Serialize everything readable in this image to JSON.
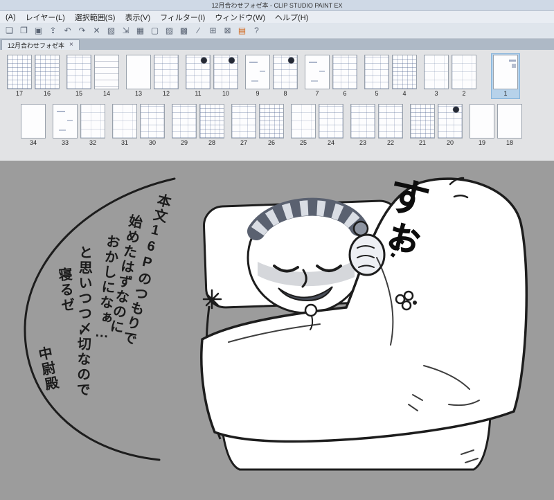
{
  "window": {
    "title": "12月合わせフォゼ本 - CLIP STUDIO PAINT EX"
  },
  "menu": {
    "items": [
      "(A)",
      "レイヤー(L)",
      "選択範囲(S)",
      "表示(V)",
      "フィルター(I)",
      "ウィンドウ(W)",
      "ヘルプ(H)"
    ]
  },
  "toolbar": {
    "icons": [
      {
        "name": "new-icon",
        "glyph": "❏"
      },
      {
        "name": "open-icon",
        "glyph": "❐"
      },
      {
        "name": "save-icon",
        "glyph": "▣"
      },
      {
        "name": "export-icon",
        "glyph": "⇪"
      },
      {
        "name": "undo-icon",
        "glyph": "↶"
      },
      {
        "name": "redo-icon",
        "glyph": "↷"
      },
      {
        "name": "clear-icon",
        "glyph": "✕"
      },
      {
        "name": "fill-icon",
        "glyph": "▧"
      },
      {
        "name": "transform-icon",
        "glyph": "⇲"
      },
      {
        "name": "crop-icon",
        "glyph": "▦"
      },
      {
        "name": "deselect-icon",
        "glyph": "▢"
      },
      {
        "name": "invert-selection-icon",
        "glyph": "▨"
      },
      {
        "name": "selection-border-icon",
        "glyph": "▩"
      },
      {
        "name": "ruler-icon",
        "glyph": "∕"
      },
      {
        "name": "snap-icon",
        "glyph": "⊞"
      },
      {
        "name": "grid-icon",
        "glyph": "⊠"
      },
      {
        "name": "material-icon",
        "glyph": "▤",
        "accent": true
      },
      {
        "name": "help-icon",
        "glyph": "?"
      }
    ]
  },
  "tabbar": {
    "tabs": [
      {
        "label": "12月合わせフォゼ本",
        "close": "×",
        "active": true
      }
    ]
  },
  "pages": {
    "row1": [
      [
        {
          "num": "17",
          "v": "dense"
        },
        {
          "num": "16",
          "v": "dense"
        }
      ],
      [
        {
          "num": "15",
          "v": "med"
        },
        {
          "num": "14",
          "v": "lines"
        }
      ],
      [
        {
          "num": "13",
          "v": "blank"
        },
        {
          "num": "12",
          "v": "med"
        }
      ],
      [
        {
          "num": "11",
          "v": "dark"
        },
        {
          "num": "10",
          "v": "dark"
        }
      ],
      [
        {
          "num": "9",
          "v": "sparse"
        },
        {
          "num": "8",
          "v": "dark"
        }
      ],
      [
        {
          "num": "7",
          "v": "sparse"
        },
        {
          "num": "6",
          "v": "med"
        }
      ],
      [
        {
          "num": "5",
          "v": "med"
        },
        {
          "num": "4",
          "v": "dense"
        }
      ],
      [
        {
          "num": "3",
          "v": "light"
        },
        {
          "num": "2",
          "v": "light"
        }
      ],
      [
        {
          "num": "1",
          "v": "first",
          "selected": true
        }
      ]
    ],
    "row2": [
      [
        {
          "num": "34",
          "v": "blank"
        }
      ],
      [
        {
          "num": "33",
          "v": "sparse"
        },
        {
          "num": "32",
          "v": "light"
        }
      ],
      [
        {
          "num": "31",
          "v": "light"
        },
        {
          "num": "30",
          "v": "med"
        }
      ],
      [
        {
          "num": "29",
          "v": "med"
        },
        {
          "num": "28",
          "v": "dense"
        }
      ],
      [
        {
          "num": "27",
          "v": "med"
        },
        {
          "num": "26",
          "v": "dense"
        }
      ],
      [
        {
          "num": "25",
          "v": "light"
        },
        {
          "num": "24",
          "v": "med"
        }
      ],
      [
        {
          "num": "23",
          "v": "med"
        },
        {
          "num": "22",
          "v": "med"
        }
      ],
      [
        {
          "num": "21",
          "v": "dense"
        },
        {
          "num": "20",
          "v": "dark"
        }
      ],
      [
        {
          "num": "19",
          "v": "blank"
        },
        {
          "num": "18",
          "v": "blank"
        }
      ]
    ]
  },
  "canvas": {
    "snore": {
      "text": "すぉ",
      "dots": "…"
    },
    "caption_columns": [
      {
        "text": "本文16Pのつもりで"
      },
      {
        "text": "始めたはずなのに"
      },
      {
        "text": "おかしになぁ…"
      },
      {
        "text": "と思いつつ〆切なので"
      },
      {
        "text": "寝るゼ"
      },
      {
        "text": "中尉殿"
      }
    ]
  },
  "colors": {
    "canvas_bg": "#9c9c9c",
    "selection": "#b7d2ea",
    "chrome": "#dfe5ec",
    "accent_orange": "#d2691e",
    "sketch_blue": "#4a608c"
  }
}
